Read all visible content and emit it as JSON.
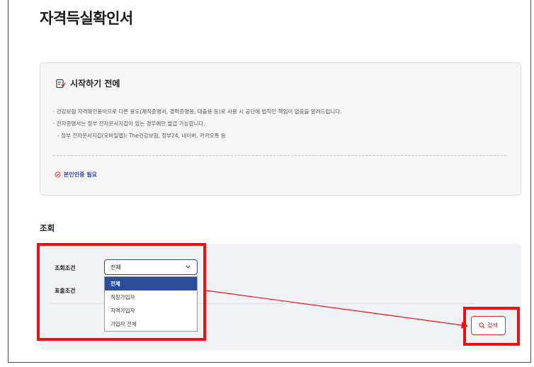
{
  "page": {
    "title": "자격득실확인서"
  },
  "notice": {
    "title": "시작하기 전에",
    "items": [
      "· 건강보험 자격확인용이므로 다른 용도(재직증명서, 경력증명용, 대출용 등)로 사용 시 공단에 법적인 책임이 없음을 알려드립니다.",
      "· 전자증명서는 정부 전자문서지갑이 있는 경우에만 발급 가능합니다.",
      "  - 정부 전자문서지갑(모바일앱): The건강보험, 정부24, 네이버, 카카오톡 등"
    ],
    "auth_required": "본인인증 필요"
  },
  "search": {
    "section_title": "조회",
    "condition_label": "조회조건",
    "submit_label": "표출조건",
    "select_value": "전체",
    "options": [
      "전체",
      "직장가입자",
      "지역가입자",
      "가입자 전체"
    ],
    "selected_option": "전체",
    "search_button": "검색"
  },
  "colors": {
    "highlight": "#ee1111",
    "selected_option_bg": "#2a4c9a",
    "search_button_accent": "#d62c2c",
    "auth_text": "#2c4bb3"
  }
}
